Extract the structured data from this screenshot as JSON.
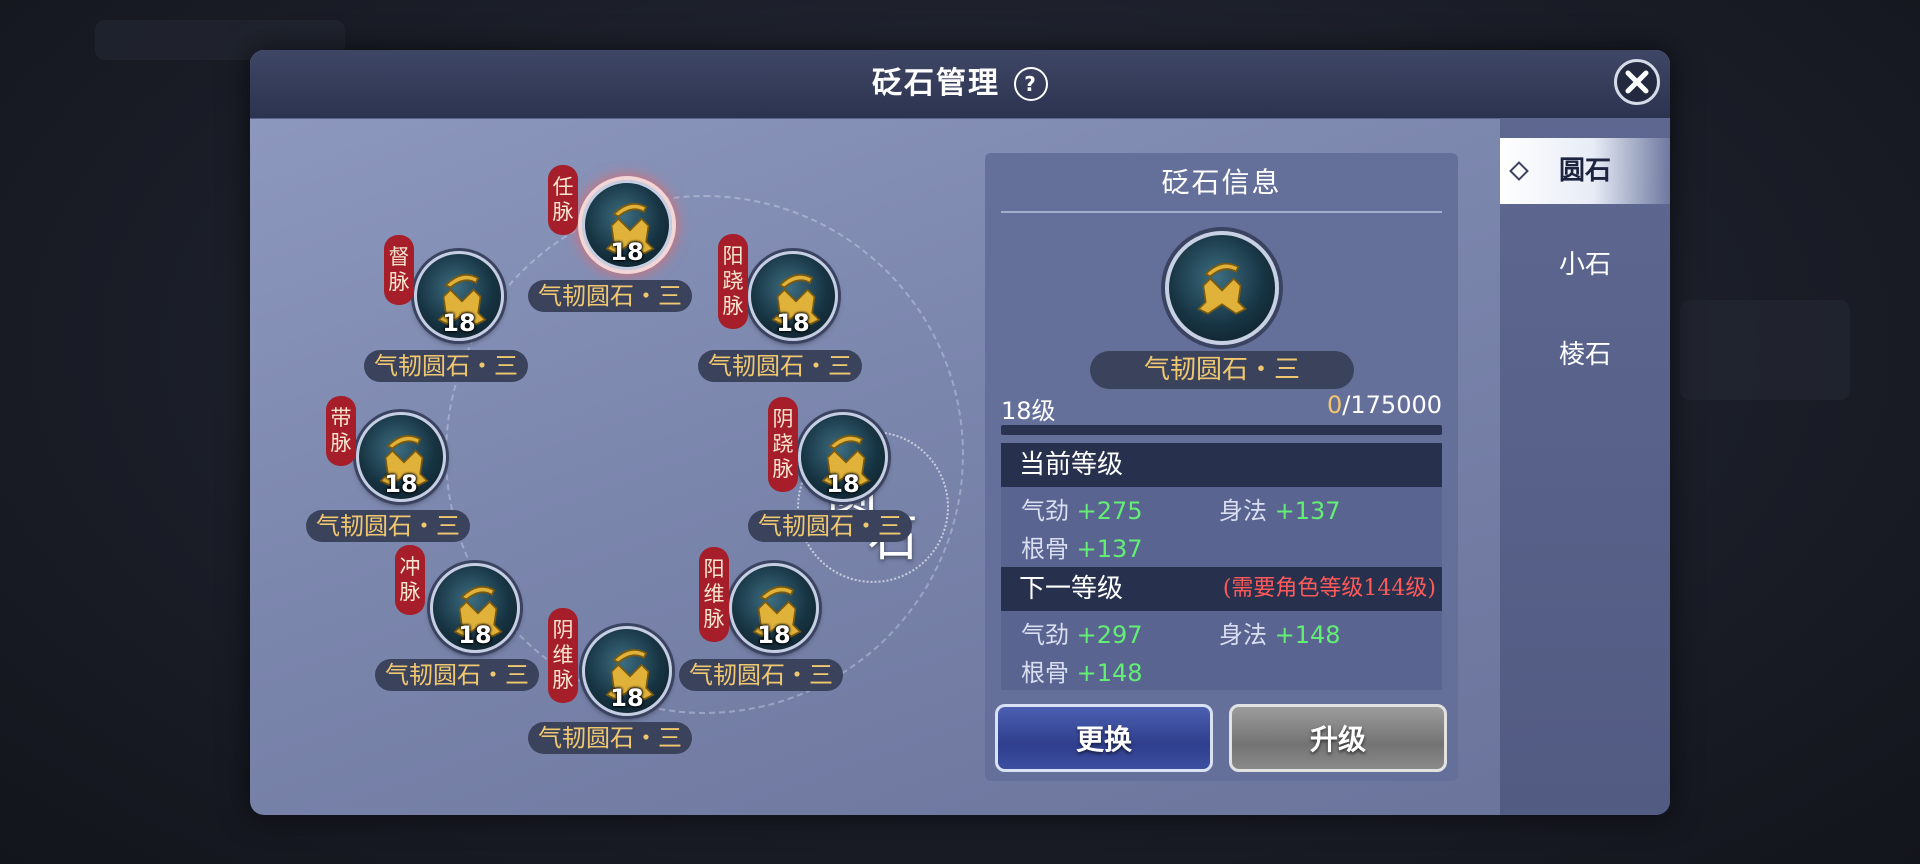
{
  "dialog": {
    "title": "砭石管理",
    "help_icon": "?"
  },
  "side_tabs": [
    {
      "label": "圆石",
      "active": true
    },
    {
      "label": "小石",
      "active": false
    },
    {
      "label": "棱石",
      "active": false
    }
  ],
  "center_label": [
    "圆",
    "石"
  ],
  "stones": [
    {
      "channel": "任脉",
      "level": "18",
      "name": "气韧圆石・三",
      "selected": true
    },
    {
      "channel": "阳跷脉",
      "level": "18",
      "name": "气韧圆石・三"
    },
    {
      "channel": "阴跷脉",
      "level": "18",
      "name": "气韧圆石・三"
    },
    {
      "channel": "阳维脉",
      "level": "18",
      "name": "气韧圆石・三"
    },
    {
      "channel": "阴维脉",
      "level": "18",
      "name": "气韧圆石・三"
    },
    {
      "channel": "冲脉",
      "level": "18",
      "name": "气韧圆石・三"
    },
    {
      "channel": "带脉",
      "level": "18",
      "name": "气韧圆石・三"
    },
    {
      "channel": "督脉",
      "level": "18",
      "name": "气韧圆石・三"
    }
  ],
  "info": {
    "title": "砭石信息",
    "name": "气韧圆石・三",
    "level": "18级",
    "exp_current": "0",
    "exp_max": "/175000",
    "exp_progress": 0,
    "current": {
      "header": "当前等级",
      "stat1_label": "气劲",
      "stat1_value": "+275",
      "stat2_label": "身法",
      "stat2_value": "+137",
      "stat3_label": "根骨",
      "stat3_value": "+137"
    },
    "next": {
      "header": "下一等级",
      "requirement": "(需要角色等级144级)",
      "stat1_label": "气劲",
      "stat1_value": "+297",
      "stat2_label": "身法",
      "stat2_value": "+148",
      "stat3_label": "根骨",
      "stat3_value": "+148"
    },
    "swap_button": "更换",
    "upgrade_button": "升级"
  },
  "colors": {
    "accent_gold": "#f0c870",
    "stat_green": "#62ef74",
    "warn_red": "#ff5a5a",
    "tag_red": "#a51e2a"
  }
}
